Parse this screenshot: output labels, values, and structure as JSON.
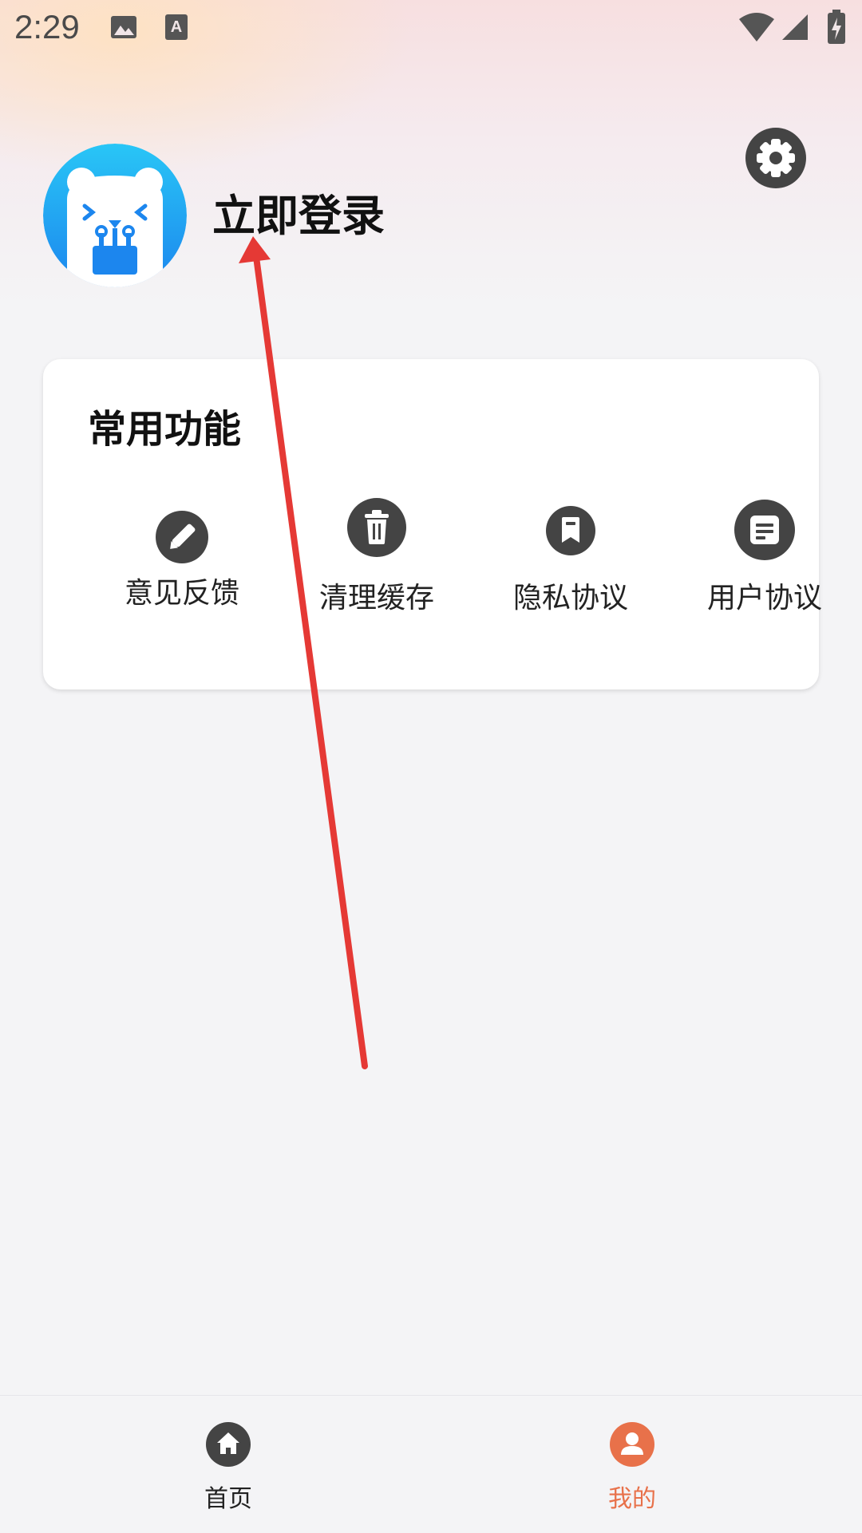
{
  "status_bar": {
    "time": "2:29",
    "icons": [
      "image-icon",
      "text-a-icon",
      "wifi-icon",
      "cellular-signal-icon",
      "battery-charging-icon"
    ]
  },
  "profile": {
    "login_label": "立即登录",
    "avatar_icon": "bear-mascot-avatar",
    "settings_icon": "gear-icon"
  },
  "common_functions": {
    "title": "常用功能",
    "items": [
      {
        "label": "意见反馈",
        "icon": "pencil-icon"
      },
      {
        "label": "清理缓存",
        "icon": "trash-icon"
      },
      {
        "label": "隐私协议",
        "icon": "bookmark-icon"
      },
      {
        "label": "用户协议",
        "icon": "document-icon"
      }
    ]
  },
  "bottom_nav": {
    "items": [
      {
        "label": "首页",
        "icon": "home-icon",
        "active": false
      },
      {
        "label": "我的",
        "icon": "user-icon",
        "active": true
      }
    ]
  },
  "colors": {
    "active": "#e8714a",
    "inactive": "#444444",
    "annotation_arrow": "#e53935"
  }
}
